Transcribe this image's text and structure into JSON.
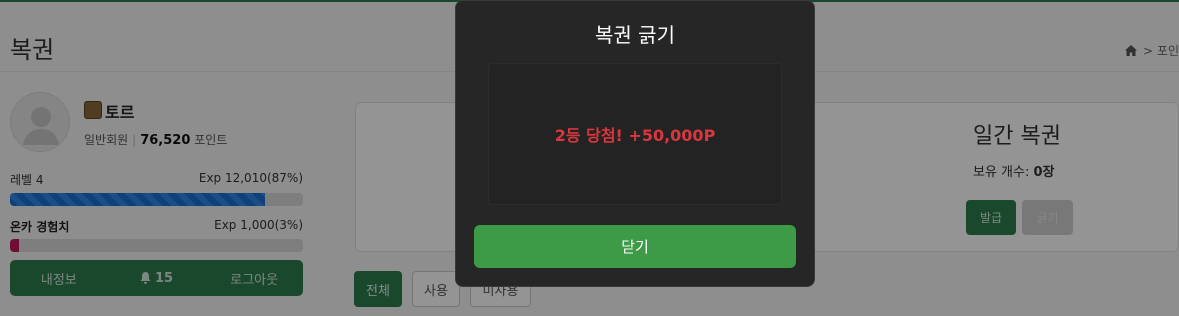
{
  "page": {
    "title": "복권",
    "breadcrumb_text": "> 포인"
  },
  "user": {
    "nickname": "토르",
    "member_type": "일반회원",
    "points_value": "76,520",
    "points_unit": "포인트",
    "level_label": "레벨 4",
    "level_exp": "Exp 12,010(87%)",
    "level_progress_percent": 87,
    "onca_label": "온카 경험치",
    "onca_exp": "Exp 1,000(3%)",
    "onca_progress_percent": 3,
    "buttons": {
      "info": "내정보",
      "notifications": "15",
      "logout": "로그아웃"
    }
  },
  "lottery_card": {
    "title": "일간 복권",
    "owned_label": "보유 개수:",
    "owned_count": "0장",
    "issue_button": "발급",
    "scratch_button": "긁기"
  },
  "filters": {
    "all": "전체",
    "used": "사용",
    "unused": "미사용"
  },
  "modal": {
    "title": "복권 긁기",
    "result": "2등 당첨! +50,000P",
    "close_button": "닫기"
  },
  "colors": {
    "brand_green": "#2e7d4f",
    "close_green": "#3d9b48",
    "result_red": "#d9363e",
    "level_bar": "#1d6fd0",
    "onca_bar": "#c2185b"
  }
}
